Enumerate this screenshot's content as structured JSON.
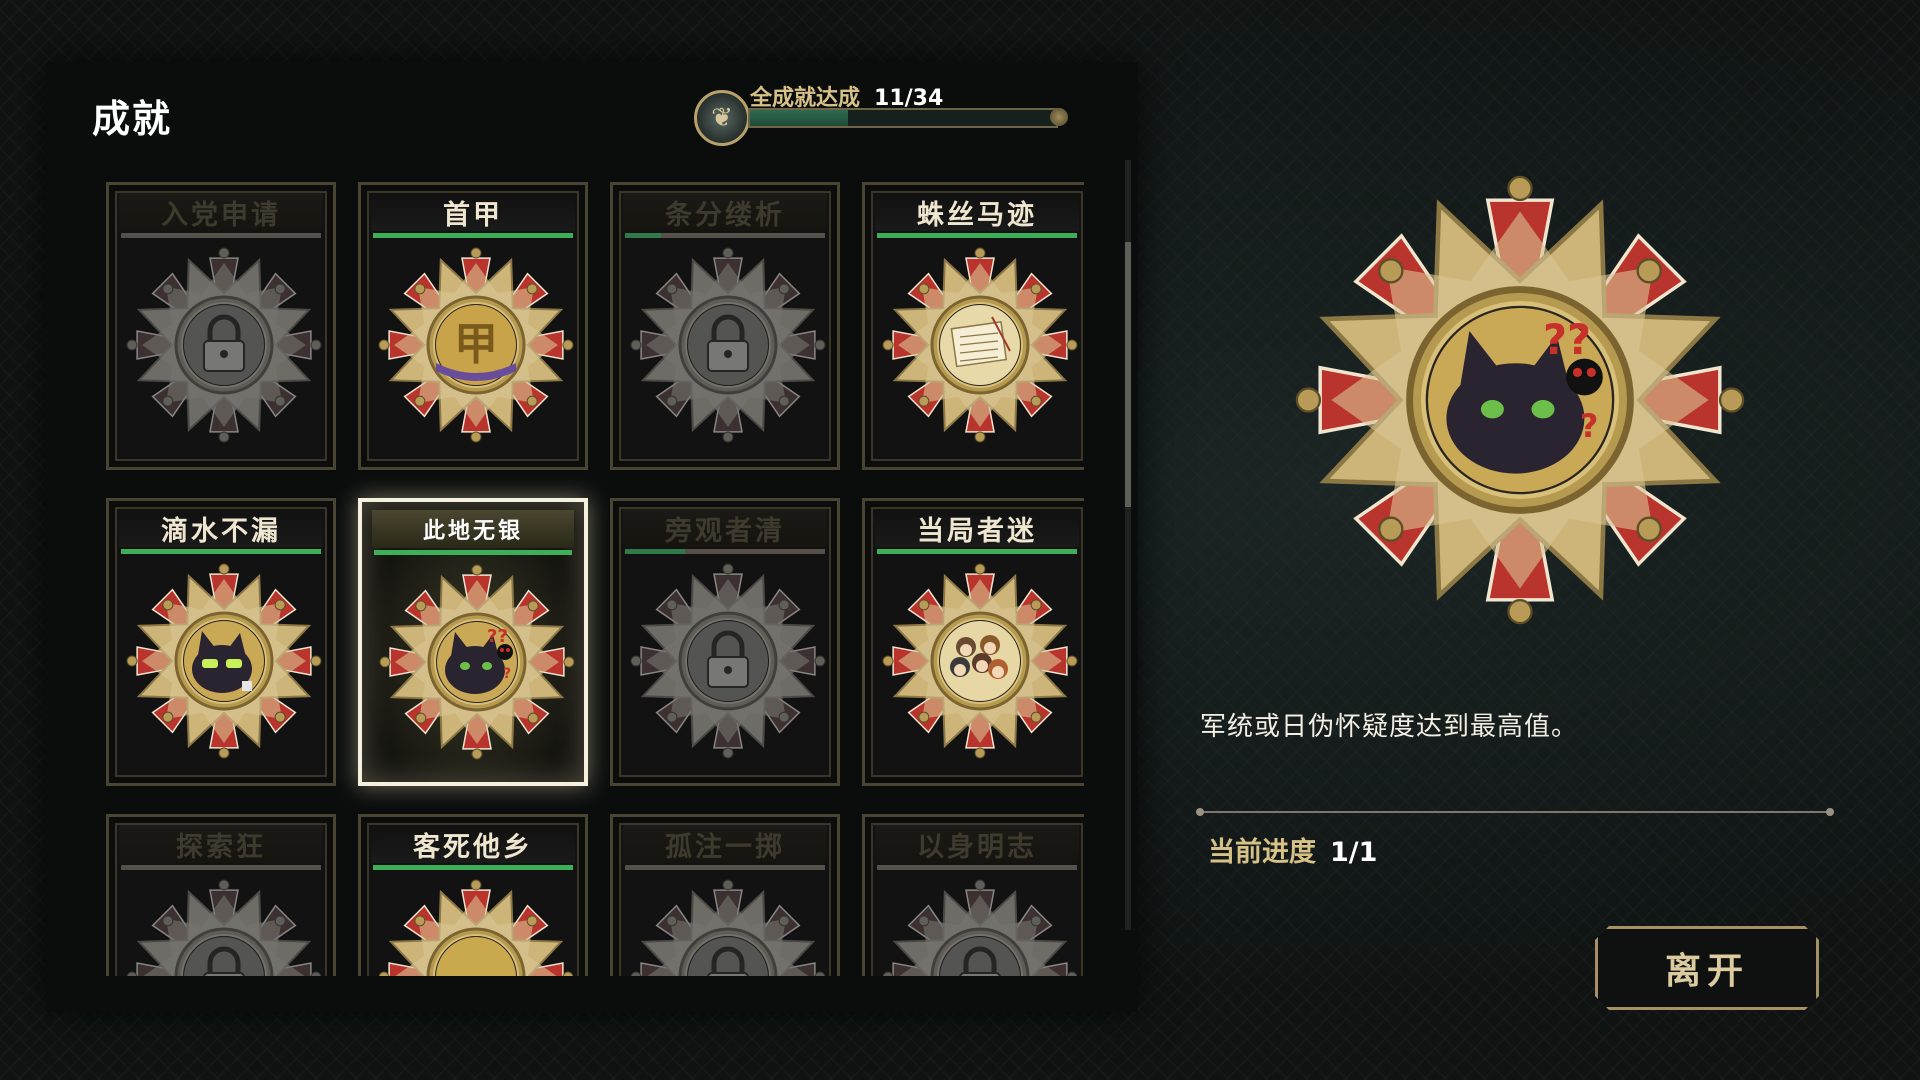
{
  "header": {
    "title": "成就",
    "overall_label": "全成就达成",
    "overall_count": "11/34",
    "overall_progress": 0.32
  },
  "achievements": [
    {
      "title": "入党申请",
      "locked": true,
      "progress": 0.0,
      "icon": "lock-icon"
    },
    {
      "title": "首甲",
      "locked": false,
      "progress": 1.0,
      "icon": "jia-character-icon",
      "glyph": "甲"
    },
    {
      "title": "条分缕析",
      "locked": true,
      "progress": 0.18,
      "icon": "lock-icon"
    },
    {
      "title": "蛛丝马迹",
      "locked": false,
      "progress": 1.0,
      "icon": "newspaper-icon"
    },
    {
      "title": "滴水不漏",
      "locked": false,
      "progress": 1.0,
      "icon": "sunglasses-cat-icon"
    },
    {
      "title": "此地无银",
      "locked": false,
      "progress": 1.0,
      "icon": "confused-black-cat-icon",
      "selected": true
    },
    {
      "title": "旁观者清",
      "locked": true,
      "progress": 0.3,
      "icon": "lock-icon"
    },
    {
      "title": "当局者迷",
      "locked": false,
      "progress": 1.0,
      "icon": "group-portrait-icon"
    },
    {
      "title": "探索狂",
      "locked": true,
      "progress": 0.0,
      "icon": "lock-icon"
    },
    {
      "title": "客死他乡",
      "locked": false,
      "progress": 1.0,
      "icon": "chrysanthemum-icon"
    },
    {
      "title": "孤注一掷",
      "locked": true,
      "progress": 0.0,
      "icon": "lock-icon"
    },
    {
      "title": "以身明志",
      "locked": true,
      "progress": 0.0,
      "icon": "lock-icon"
    }
  ],
  "detail": {
    "icon": "confused-black-cat-icon",
    "description": "军统或日伪怀疑度达到最高值。",
    "progress_label": "当前进度",
    "progress_value": "1/1"
  },
  "buttons": {
    "leave": "离开"
  },
  "colors": {
    "accent_gold": "#d6c187",
    "progress_green": "#3fae58",
    "medal_red": "#b8342c"
  }
}
